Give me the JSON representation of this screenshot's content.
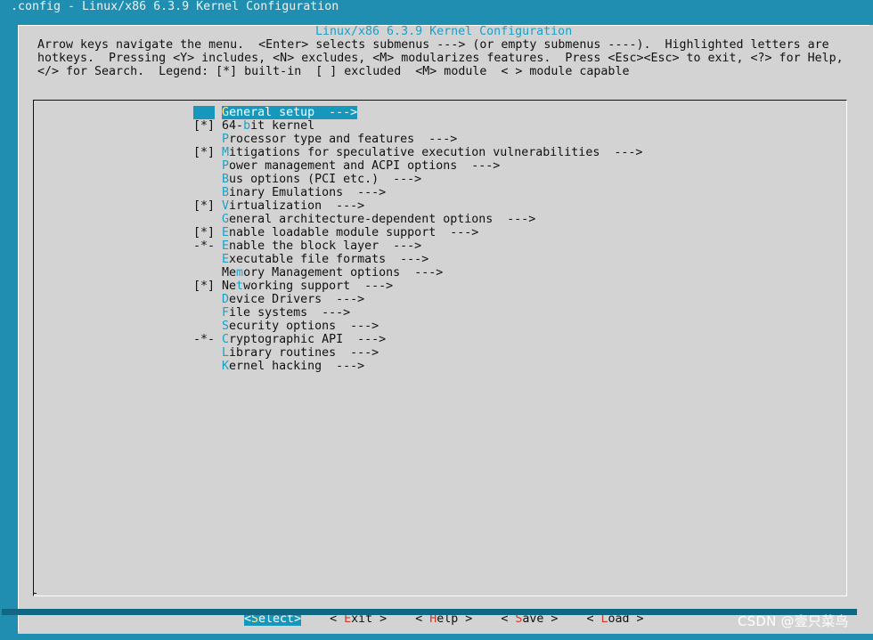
{
  "window": {
    "title": ".config - Linux/x86 6.3.9 Kernel Configuration"
  },
  "dialog": {
    "title": "Linux/x86 6.3.9 Kernel Configuration",
    "help_lines": [
      "Arrow keys navigate the menu.  <Enter> selects submenus ---> (or empty submenus ----).  Highlighted letters are",
      "hotkeys.  Pressing <Y> includes, <N> excludes, <M> modularizes features.  Press <Esc><Esc> to exit, <?> for Help,",
      "</> for Search.  Legend: [*] built-in  [ ] excluded  <M> module  < > module capable"
    ]
  },
  "menu": {
    "items": [
      {
        "prefix": "   ",
        "hotkey": "G",
        "rest": "eneral setup  --->",
        "selected": true
      },
      {
        "prefix": "[*] ",
        "pre": "64-",
        "hotkey": "b",
        "rest": "it kernel",
        "selected": false
      },
      {
        "prefix": "    ",
        "hotkey": "P",
        "rest": "rocessor type and features  --->",
        "selected": false
      },
      {
        "prefix": "[*] ",
        "hotkey": "M",
        "rest": "itigations for speculative execution vulnerabilities  --->",
        "selected": false
      },
      {
        "prefix": "    ",
        "hotkey": "P",
        "rest": "ower management and ACPI options  --->",
        "selected": false
      },
      {
        "prefix": "    ",
        "hotkey": "B",
        "rest": "us options (PCI etc.)  --->",
        "selected": false
      },
      {
        "prefix": "    ",
        "hotkey": "B",
        "rest": "inary Emulations  --->",
        "selected": false
      },
      {
        "prefix": "[*] ",
        "hotkey": "V",
        "rest": "irtualization  --->",
        "selected": false
      },
      {
        "prefix": "    ",
        "hotkey": "G",
        "rest": "eneral architecture-dependent options  --->",
        "selected": false
      },
      {
        "prefix": "[*] ",
        "hotkey": "E",
        "rest": "nable loadable module support  --->",
        "selected": false
      },
      {
        "prefix": "-*- ",
        "hotkey": "E",
        "rest": "nable the block layer  --->",
        "selected": false
      },
      {
        "prefix": "    ",
        "hotkey": "E",
        "rest": "xecutable file formats  --->",
        "selected": false
      },
      {
        "prefix": "    ",
        "pre": "Me",
        "hotkey": "m",
        "rest": "ory Management options  --->",
        "selected": false
      },
      {
        "prefix": "[*] ",
        "pre": "Ne",
        "hotkey": "t",
        "rest": "working support  --->",
        "selected": false
      },
      {
        "prefix": "    ",
        "hotkey": "D",
        "rest": "evice Drivers  --->",
        "selected": false
      },
      {
        "prefix": "    ",
        "hotkey": "F",
        "rest": "ile systems  --->",
        "selected": false
      },
      {
        "prefix": "    ",
        "hotkey": "S",
        "rest": "ecurity options  --->",
        "selected": false
      },
      {
        "prefix": "-*- ",
        "hotkey": "C",
        "rest": "ryptographic API  --->",
        "selected": false
      },
      {
        "prefix": "    ",
        "hotkey": "L",
        "rest": "ibrary routines  --->",
        "selected": false
      },
      {
        "prefix": "    ",
        "hotkey": "K",
        "rest": "ernel hacking  --->",
        "selected": false
      }
    ]
  },
  "buttons": [
    {
      "open": "<",
      "hotkey": "S",
      "rest": "elect",
      "close": ">",
      "selected": true
    },
    {
      "open": "< ",
      "hotkey": "E",
      "rest": "xit",
      "close": " >",
      "selected": false
    },
    {
      "open": "< ",
      "hotkey": "H",
      "rest": "elp",
      "close": " >",
      "selected": false
    },
    {
      "open": "< ",
      "hotkey": "S",
      "rest": "ave",
      "close": " >",
      "selected": false
    },
    {
      "open": "< ",
      "hotkey": "L",
      "rest": "oad",
      "close": " >",
      "selected": false
    }
  ],
  "watermark": "CSDN @壹只菜鸟",
  "colors": {
    "background": "#1f8eb0",
    "dialog": "#d3d3d3",
    "highlight": "#1897bd",
    "hotkey": "#1aa0c6",
    "button_hotkey": "#d0382b"
  }
}
